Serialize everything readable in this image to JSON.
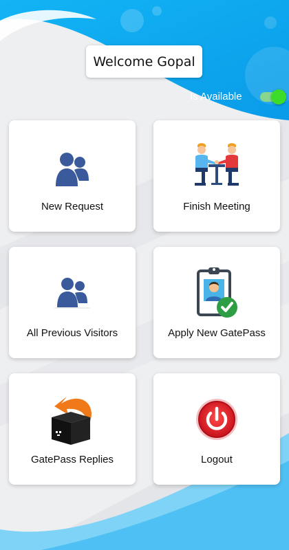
{
  "header": {
    "welcome": "Welcome Gopal",
    "availability_label": "Is Available",
    "availability_on": true
  },
  "tiles": [
    {
      "label": "New Request",
      "icon": "people-icon"
    },
    {
      "label": "Finish Meeting",
      "icon": "meeting-icon"
    },
    {
      "label": "All Previous Visitors",
      "icon": "visitors-icon"
    },
    {
      "label": "Apply New GatePass",
      "icon": "gatepass-badge-icon"
    },
    {
      "label": "GatePass Replies",
      "icon": "reply-box-icon"
    },
    {
      "label": "Logout",
      "icon": "power-icon"
    }
  ],
  "colors": {
    "primary_blue": "#0aa6ef",
    "light_blue": "#7fd3f7",
    "toggle_on": "#3ddc2a",
    "logout_red": "#e8202a",
    "people_blue": "#3a5a9b"
  }
}
